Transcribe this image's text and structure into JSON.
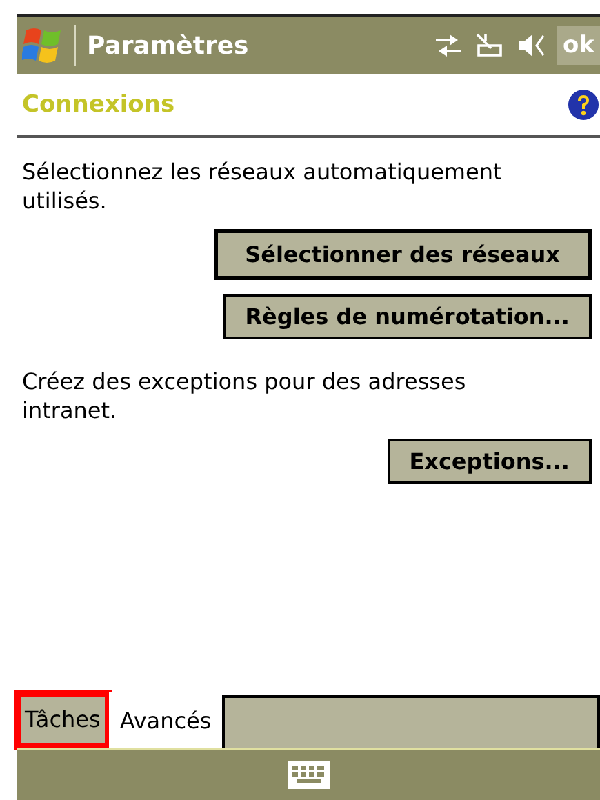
{
  "title_bar": {
    "title": "Paramètres",
    "ok_label": "ok"
  },
  "header": {
    "title": "Connexions"
  },
  "sections": [
    {
      "text": "Sélectionnez les réseaux automatiquement utilisés.",
      "buttons": [
        {
          "label": "Sélectionner des réseaux",
          "focused": true
        },
        {
          "label": "Règles de numérotation...",
          "focused": false
        }
      ]
    },
    {
      "text": "Créez des exceptions pour des adresses intranet.",
      "buttons": [
        {
          "label": "Exceptions...",
          "focused": false
        }
      ]
    }
  ],
  "tabs": [
    {
      "label": "Tâches",
      "selected": false,
      "highlighted": true
    },
    {
      "label": "Avancés",
      "selected": true,
      "highlighted": false
    }
  ]
}
